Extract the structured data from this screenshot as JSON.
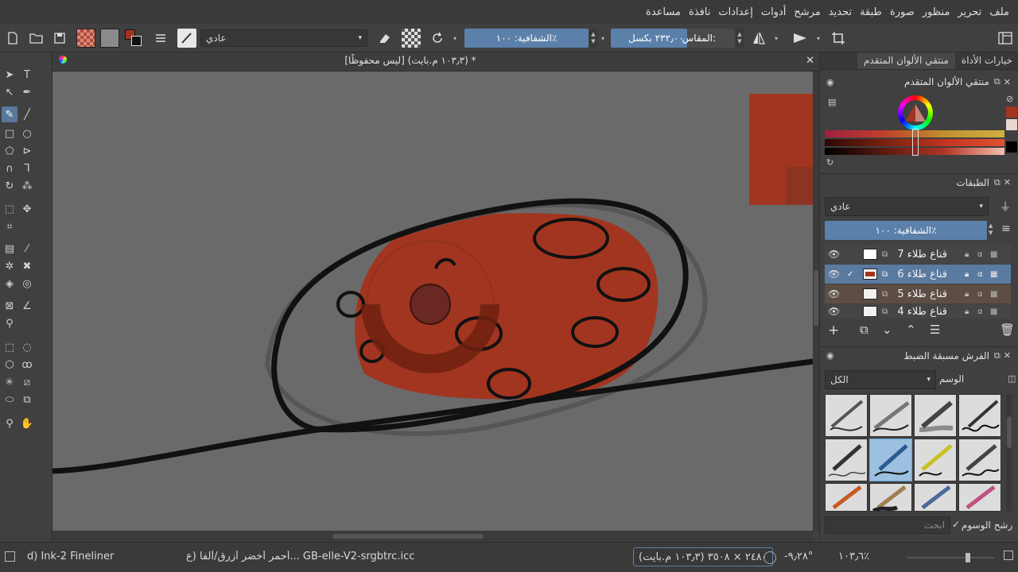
{
  "menubar": {
    "items": [
      "ملف",
      "تحرير",
      "منظور",
      "صورة",
      "طبقة",
      "تحديد",
      "مرشح",
      "أدوات",
      "إعدادات",
      "نافذة",
      "مساعدة"
    ]
  },
  "toolbar": {
    "blend_mode": "عادي",
    "opacity_label": "الشفافية: ١٠٠٪",
    "size_label": "المقاس:",
    "size_value": "٢٣٢٫٠٠ بكسل"
  },
  "document": {
    "title": "* (١٠٣٫٣ م.بايت)  [ليس محفوظًا]"
  },
  "dockers": {
    "tabs": [
      "خيارات الأداة",
      "منتقي الألوان المتقدم"
    ],
    "color_selector_title": "منتقي الألوان المتقدم",
    "layers_title": "الطبقات",
    "layers_blend": "عادي",
    "layers_opacity": "الشفافية: ١٠٠٪",
    "layers": [
      {
        "name": "قناع طلاء 7",
        "state": "normal"
      },
      {
        "name": "قناع طلاء 6",
        "state": "selected"
      },
      {
        "name": "قناع طلاء 5",
        "state": "locked"
      },
      {
        "name": "قناع طلاء 4",
        "state": "normal"
      }
    ],
    "presets_title": "الفرش مسبقة الضبط",
    "presets_filter": "الكل",
    "presets_tag_label": "الوسم",
    "tag_filter_label": "رشح الوسوم",
    "search_placeholder": "ابحث"
  },
  "status": {
    "brush_name": "d) Ink-2 Fineliner",
    "color_profile": "أحمر أخضر أزرق/ألفا (ع...  GB-elle-V2-srgbtrc.icc",
    "image_size": "٢٤٨٠ × ٣٥٠٨ (١٠٣٫٣ م.بايت)",
    "rotation": "-٩٫٢٨°",
    "zoom": "١٠٣٫٦٪"
  },
  "colors": {
    "accent": "#5b80aa",
    "paint": "#a23520",
    "canvas_bg": "#6a6a6a"
  }
}
